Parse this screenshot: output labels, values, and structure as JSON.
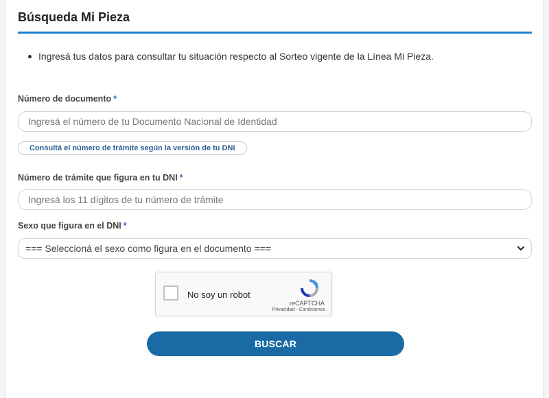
{
  "page": {
    "title": "Búsqueda Mi Pieza",
    "intro_bullet": "Ingresá tus datos para consultar tu situación respecto al Sorteo vigente de la Línea Mi Pieza."
  },
  "form": {
    "documento": {
      "label": "Número de documento",
      "required_mark": "*",
      "placeholder": "Ingresá el número de tu Documento Nacional de Identidad",
      "value": ""
    },
    "tramite_help": {
      "label": "Consultá el número de trámite según la versión de tu DNI"
    },
    "tramite": {
      "label": "Número de trámite que figura en tu DNI",
      "required_mark": "*",
      "placeholder": "Ingresá los 11 dígitos de tu número de trámite",
      "value": ""
    },
    "sexo": {
      "label": "Sexo que figura en el DNI",
      "required_mark": "*",
      "selected": "=== Seleccioná el sexo como figura en el documento ==="
    }
  },
  "captcha": {
    "label": "No soy un robot",
    "brand": "reCAPTCHA",
    "terms": "Privacidad - Condiciones",
    "checked": false
  },
  "actions": {
    "submit_label": "BUSCAR"
  },
  "colors": {
    "accent_rule": "#1e7fd0",
    "button": "#1a6aa5",
    "required": "#2d6cc0",
    "link": "#2b5f96"
  }
}
